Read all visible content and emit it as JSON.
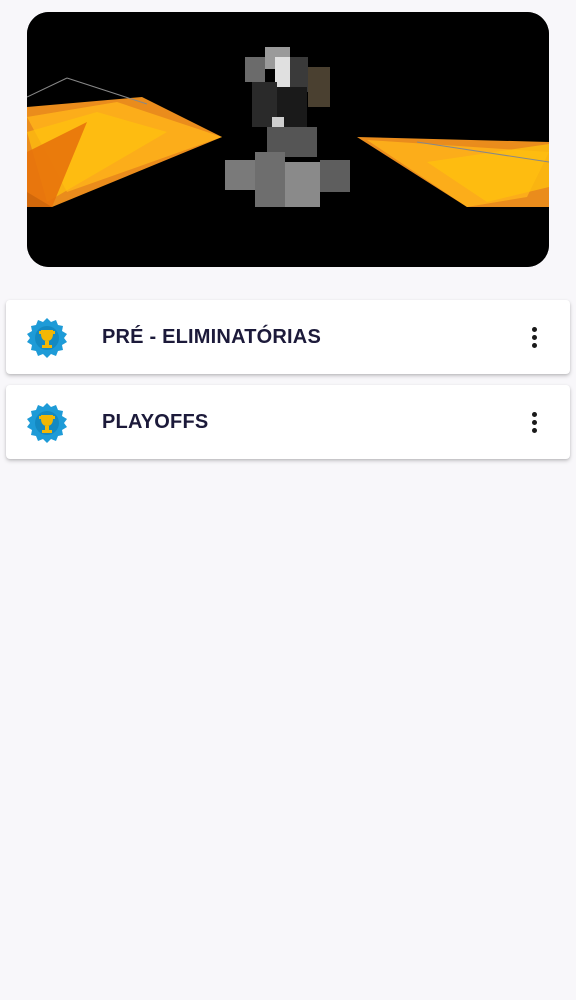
{
  "banner": {
    "image_name": "competition-logo-banner",
    "colors": {
      "background": "#000000",
      "accent_orange": "#f7931e",
      "accent_yellow": "#ffc20e"
    }
  },
  "phases": [
    {
      "label": "PRÉ - ELIMINATÓRIAS",
      "icon": "trophy-badge-icon"
    },
    {
      "label": "PLAYOFFS",
      "icon": "trophy-badge-icon"
    }
  ],
  "colors": {
    "page_background": "#f8f7fa",
    "card_background": "#ffffff",
    "label_text": "#1c1a3a",
    "badge_blue": "#1e9bd7",
    "trophy_gold": "#f2b705"
  }
}
